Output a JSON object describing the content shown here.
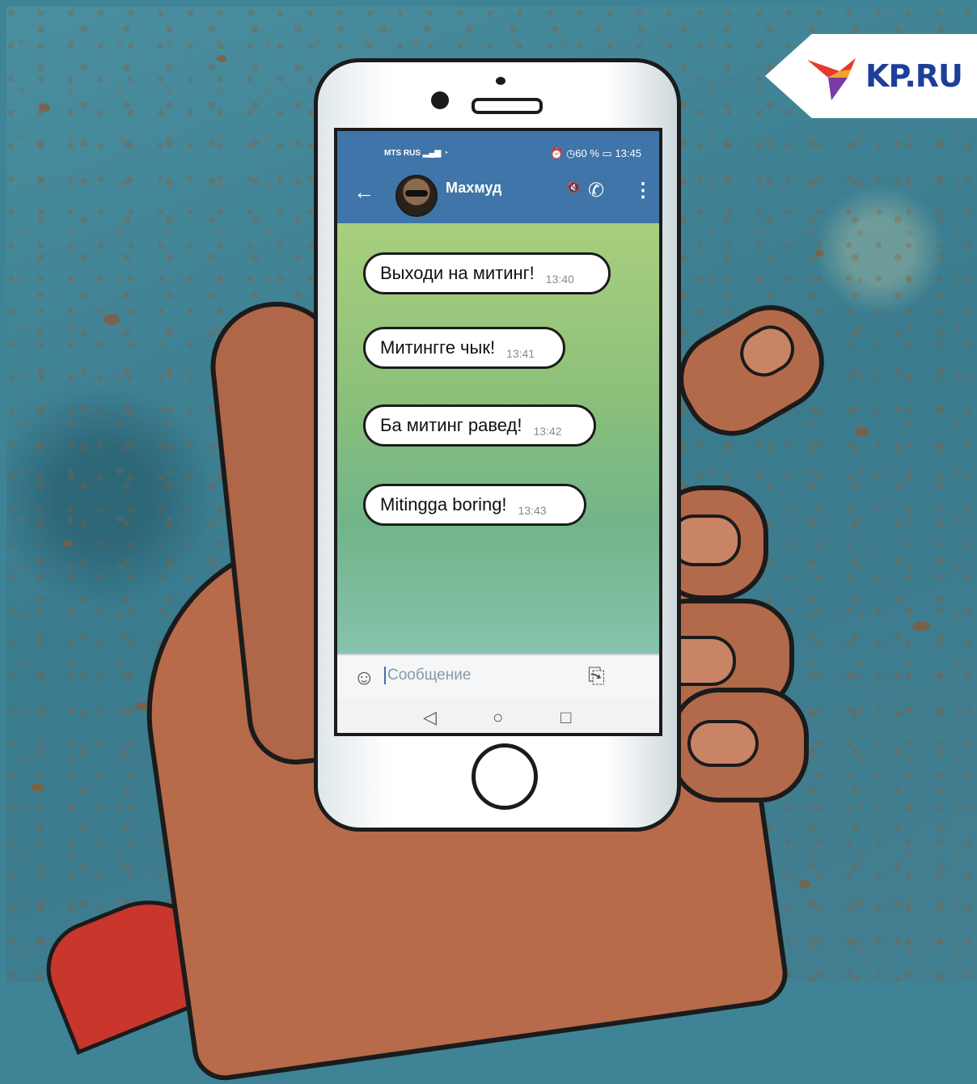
{
  "logo": {
    "text": "KP.RU",
    "bird_colors": [
      "#e53a2e",
      "#f3a425",
      "#7a3ba5",
      "#1d3f99"
    ]
  },
  "status_bar": {
    "carrier": "MTS RUS",
    "battery": "60 %",
    "time": "13:45"
  },
  "header": {
    "back_icon": "back-arrow-icon",
    "contact_name": "Махмуд",
    "accent_color": "#3f75a8"
  },
  "messages": [
    {
      "text": "Выходи на митинг!",
      "time": "13:40"
    },
    {
      "text": "Митингге чык!",
      "time": "13:41"
    },
    {
      "text": "Ба митинг равед!",
      "time": "13:42"
    },
    {
      "text": "Mitingga boring!",
      "time": "13:43"
    }
  ],
  "composer": {
    "placeholder": "Сообщение"
  },
  "nav_bar": {
    "back": "◁",
    "home": "○",
    "recents": "□"
  }
}
